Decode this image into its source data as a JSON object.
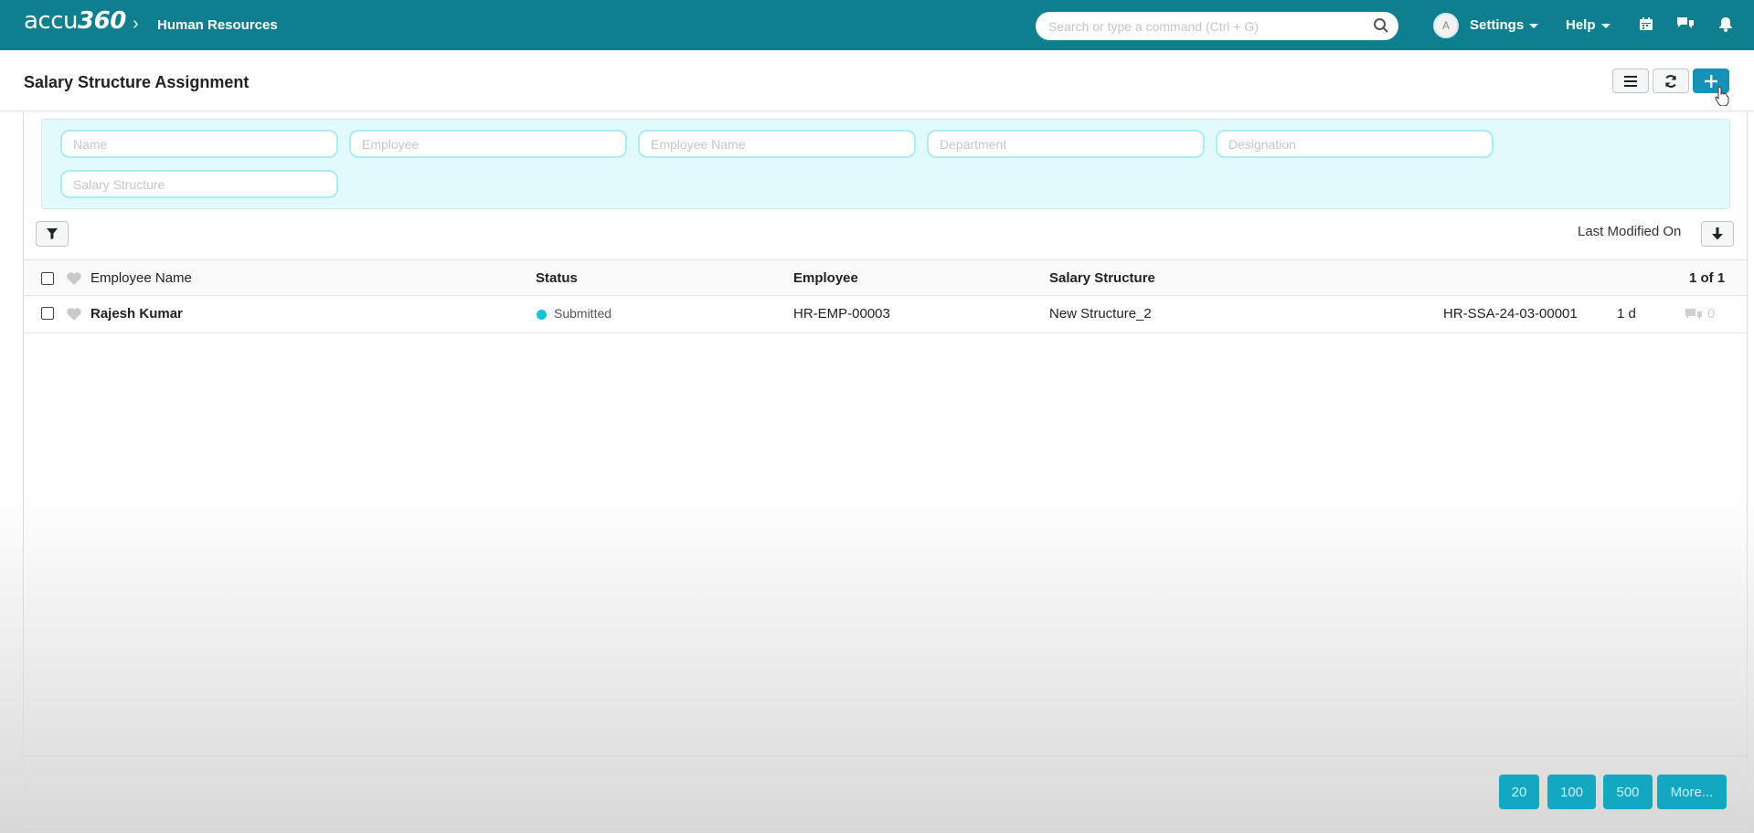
{
  "topbar": {
    "logo_text": "accu",
    "logo_num": "360",
    "breadcrumb": "Human Resources",
    "search_placeholder": "Search or type a command (Ctrl + G)",
    "avatar_initial": "A",
    "settings_label": "Settings",
    "help_label": "Help"
  },
  "header": {
    "title": "Salary Structure Assignment"
  },
  "filters": {
    "name": "Name",
    "employee": "Employee",
    "employee_name": "Employee Name",
    "department": "Department",
    "designation": "Designation",
    "salary_structure": "Salary Structure"
  },
  "sort": {
    "label": "Last Modified On"
  },
  "list": {
    "columns": {
      "employee_name": "Employee Name",
      "status": "Status",
      "employee": "Employee",
      "salary_structure": "Salary Structure",
      "count": "1 of 1"
    },
    "rows": [
      {
        "employee_name": "Rajesh Kumar",
        "status": "Submitted",
        "employee": "HR-EMP-00003",
        "salary_structure": "New Structure_2",
        "id": "HR-SSA-24-03-00001",
        "modified": "1 d",
        "comments": "0"
      }
    ]
  },
  "paging": {
    "p20": "20",
    "p100": "100",
    "p500": "500",
    "more": "More..."
  },
  "colors": {
    "nav": "#0d7f8f",
    "primary": "#1592b5",
    "filter_bg": "#e2fafd",
    "status_submitted": "#0ec5dc"
  }
}
